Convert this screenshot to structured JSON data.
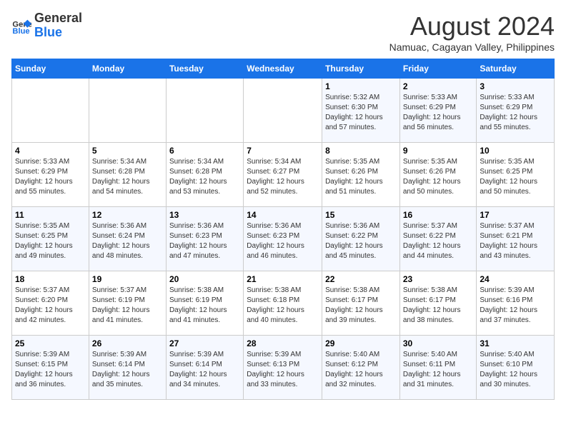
{
  "header": {
    "logo_line1": "General",
    "logo_line2": "Blue",
    "month_year": "August 2024",
    "location": "Namuac, Cagayan Valley, Philippines"
  },
  "days_of_week": [
    "Sunday",
    "Monday",
    "Tuesday",
    "Wednesday",
    "Thursday",
    "Friday",
    "Saturday"
  ],
  "weeks": [
    [
      {
        "day": "",
        "info": ""
      },
      {
        "day": "",
        "info": ""
      },
      {
        "day": "",
        "info": ""
      },
      {
        "day": "",
        "info": ""
      },
      {
        "day": "1",
        "info": "Sunrise: 5:32 AM\nSunset: 6:30 PM\nDaylight: 12 hours\nand 57 minutes."
      },
      {
        "day": "2",
        "info": "Sunrise: 5:33 AM\nSunset: 6:29 PM\nDaylight: 12 hours\nand 56 minutes."
      },
      {
        "day": "3",
        "info": "Sunrise: 5:33 AM\nSunset: 6:29 PM\nDaylight: 12 hours\nand 55 minutes."
      }
    ],
    [
      {
        "day": "4",
        "info": "Sunrise: 5:33 AM\nSunset: 6:29 PM\nDaylight: 12 hours\nand 55 minutes."
      },
      {
        "day": "5",
        "info": "Sunrise: 5:34 AM\nSunset: 6:28 PM\nDaylight: 12 hours\nand 54 minutes."
      },
      {
        "day": "6",
        "info": "Sunrise: 5:34 AM\nSunset: 6:28 PM\nDaylight: 12 hours\nand 53 minutes."
      },
      {
        "day": "7",
        "info": "Sunrise: 5:34 AM\nSunset: 6:27 PM\nDaylight: 12 hours\nand 52 minutes."
      },
      {
        "day": "8",
        "info": "Sunrise: 5:35 AM\nSunset: 6:26 PM\nDaylight: 12 hours\nand 51 minutes."
      },
      {
        "day": "9",
        "info": "Sunrise: 5:35 AM\nSunset: 6:26 PM\nDaylight: 12 hours\nand 50 minutes."
      },
      {
        "day": "10",
        "info": "Sunrise: 5:35 AM\nSunset: 6:25 PM\nDaylight: 12 hours\nand 50 minutes."
      }
    ],
    [
      {
        "day": "11",
        "info": "Sunrise: 5:35 AM\nSunset: 6:25 PM\nDaylight: 12 hours\nand 49 minutes."
      },
      {
        "day": "12",
        "info": "Sunrise: 5:36 AM\nSunset: 6:24 PM\nDaylight: 12 hours\nand 48 minutes."
      },
      {
        "day": "13",
        "info": "Sunrise: 5:36 AM\nSunset: 6:23 PM\nDaylight: 12 hours\nand 47 minutes."
      },
      {
        "day": "14",
        "info": "Sunrise: 5:36 AM\nSunset: 6:23 PM\nDaylight: 12 hours\nand 46 minutes."
      },
      {
        "day": "15",
        "info": "Sunrise: 5:36 AM\nSunset: 6:22 PM\nDaylight: 12 hours\nand 45 minutes."
      },
      {
        "day": "16",
        "info": "Sunrise: 5:37 AM\nSunset: 6:22 PM\nDaylight: 12 hours\nand 44 minutes."
      },
      {
        "day": "17",
        "info": "Sunrise: 5:37 AM\nSunset: 6:21 PM\nDaylight: 12 hours\nand 43 minutes."
      }
    ],
    [
      {
        "day": "18",
        "info": "Sunrise: 5:37 AM\nSunset: 6:20 PM\nDaylight: 12 hours\nand 42 minutes."
      },
      {
        "day": "19",
        "info": "Sunrise: 5:37 AM\nSunset: 6:19 PM\nDaylight: 12 hours\nand 41 minutes."
      },
      {
        "day": "20",
        "info": "Sunrise: 5:38 AM\nSunset: 6:19 PM\nDaylight: 12 hours\nand 41 minutes."
      },
      {
        "day": "21",
        "info": "Sunrise: 5:38 AM\nSunset: 6:18 PM\nDaylight: 12 hours\nand 40 minutes."
      },
      {
        "day": "22",
        "info": "Sunrise: 5:38 AM\nSunset: 6:17 PM\nDaylight: 12 hours\nand 39 minutes."
      },
      {
        "day": "23",
        "info": "Sunrise: 5:38 AM\nSunset: 6:17 PM\nDaylight: 12 hours\nand 38 minutes."
      },
      {
        "day": "24",
        "info": "Sunrise: 5:39 AM\nSunset: 6:16 PM\nDaylight: 12 hours\nand 37 minutes."
      }
    ],
    [
      {
        "day": "25",
        "info": "Sunrise: 5:39 AM\nSunset: 6:15 PM\nDaylight: 12 hours\nand 36 minutes."
      },
      {
        "day": "26",
        "info": "Sunrise: 5:39 AM\nSunset: 6:14 PM\nDaylight: 12 hours\nand 35 minutes."
      },
      {
        "day": "27",
        "info": "Sunrise: 5:39 AM\nSunset: 6:14 PM\nDaylight: 12 hours\nand 34 minutes."
      },
      {
        "day": "28",
        "info": "Sunrise: 5:39 AM\nSunset: 6:13 PM\nDaylight: 12 hours\nand 33 minutes."
      },
      {
        "day": "29",
        "info": "Sunrise: 5:40 AM\nSunset: 6:12 PM\nDaylight: 12 hours\nand 32 minutes."
      },
      {
        "day": "30",
        "info": "Sunrise: 5:40 AM\nSunset: 6:11 PM\nDaylight: 12 hours\nand 31 minutes."
      },
      {
        "day": "31",
        "info": "Sunrise: 5:40 AM\nSunset: 6:10 PM\nDaylight: 12 hours\nand 30 minutes."
      }
    ]
  ]
}
